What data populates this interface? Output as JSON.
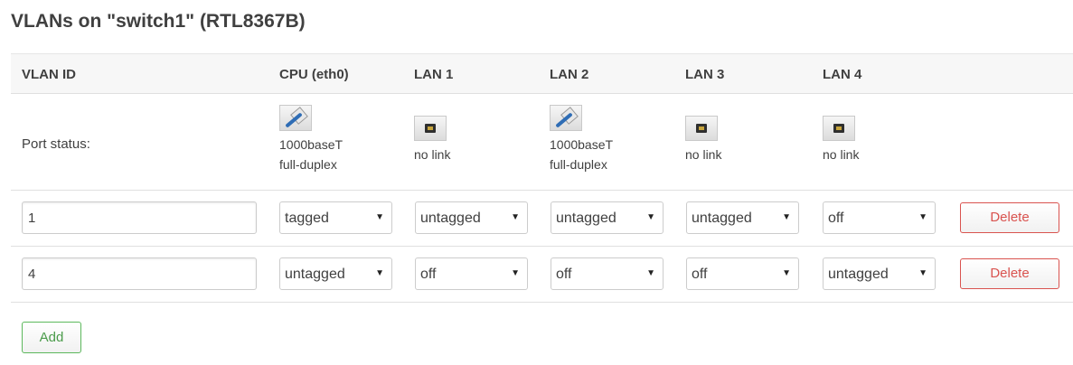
{
  "title": "VLANs on \"switch1\" (RTL8367B)",
  "headers": {
    "vlan_id": "VLAN ID",
    "cpu": "CPU (eth0)",
    "lan1": "LAN 1",
    "lan2": "LAN 2",
    "lan3": "LAN 3",
    "lan4": "LAN 4"
  },
  "status_label": "Port status:",
  "ports": [
    {
      "linked": true,
      "icon": "port-linked-icon",
      "line1": "1000baseT",
      "line2": "full-duplex"
    },
    {
      "linked": false,
      "icon": "port-nolink-icon",
      "line1": "no link",
      "line2": ""
    },
    {
      "linked": true,
      "icon": "port-linked-icon",
      "line1": "1000baseT",
      "line2": "full-duplex"
    },
    {
      "linked": false,
      "icon": "port-nolink-icon",
      "line1": "no link",
      "line2": ""
    },
    {
      "linked": false,
      "icon": "port-nolink-icon",
      "line1": "no link",
      "line2": ""
    }
  ],
  "vlans": [
    {
      "id": "1",
      "ports": [
        "tagged",
        "untagged",
        "untagged",
        "untagged",
        "off"
      ],
      "delete_label": "Delete"
    },
    {
      "id": "4",
      "ports": [
        "untagged",
        "off",
        "off",
        "off",
        "untagged"
      ],
      "delete_label": "Delete"
    }
  ],
  "add_label": "Add",
  "colors": {
    "delete": "#d9534f",
    "add": "#5cb85c",
    "cable": "#2f6db5"
  }
}
